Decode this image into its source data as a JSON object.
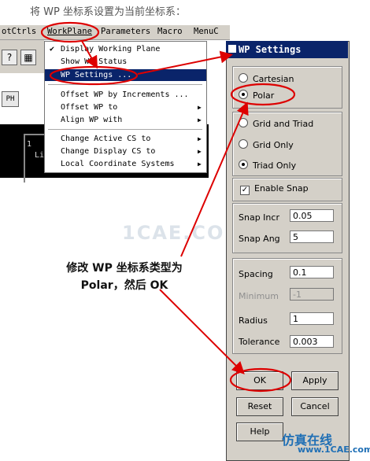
{
  "caption": "将 WP 坐标系设置为当前坐标系：",
  "menubar": [
    "otCtrls",
    "WorkPlane",
    "Parameters",
    "Macro",
    "MenuC"
  ],
  "workplane_menu": [
    {
      "label": "Display Working Plane",
      "checked": true
    },
    {
      "label": "Show WP Status"
    },
    {
      "label": "WP Settings ...",
      "selected": true
    },
    {
      "label": "Offset WP by Increments ..."
    },
    {
      "label": "Offset WP to",
      "submenu": true
    },
    {
      "label": "Align WP with",
      "submenu": true
    },
    {
      "label": "Change Active CS to",
      "submenu": true
    },
    {
      "label": "Change Display CS to",
      "submenu": true
    },
    {
      "label": "Local Coordinate Systems",
      "submenu": true
    }
  ],
  "left_panel": {
    "gph_button": "PH",
    "graphics_number": "1",
    "graphics_text": "Li"
  },
  "dialog": {
    "title": "WP Settings",
    "coord_types": [
      "Cartesian",
      "Polar"
    ],
    "coord_selected": "Polar",
    "display_options": [
      "Grid and Triad",
      "Grid Only",
      "Triad Only"
    ],
    "display_selected": "Triad Only",
    "enable_snap_label": "Enable Snap",
    "enable_snap": true,
    "snap_incr_label": "Snap Incr",
    "snap_incr": "0.05",
    "snap_ang_label": "Snap Ang",
    "snap_ang": "5",
    "spacing_label": "Spacing",
    "spacing": "0.1",
    "minimum_label": "Minimum",
    "minimum": "-1",
    "radius_label": "Radius",
    "radius": "1",
    "tolerance_label": "Tolerance",
    "tolerance": "0.003",
    "ok": "OK",
    "apply": "Apply",
    "reset": "Reset",
    "cancel": "Cancel",
    "help": "Help"
  },
  "annotation": [
    "修改 WP 坐标系类型为",
    "Polar，然后 OK"
  ],
  "watermarks": [
    "1CAE.COM",
    "仿真在线",
    "www.1CAE.com"
  ],
  "colors": {
    "highlight": "#0a246a",
    "annotation_red": "#dd0000",
    "dialog_bg": "#d4d0c8"
  }
}
